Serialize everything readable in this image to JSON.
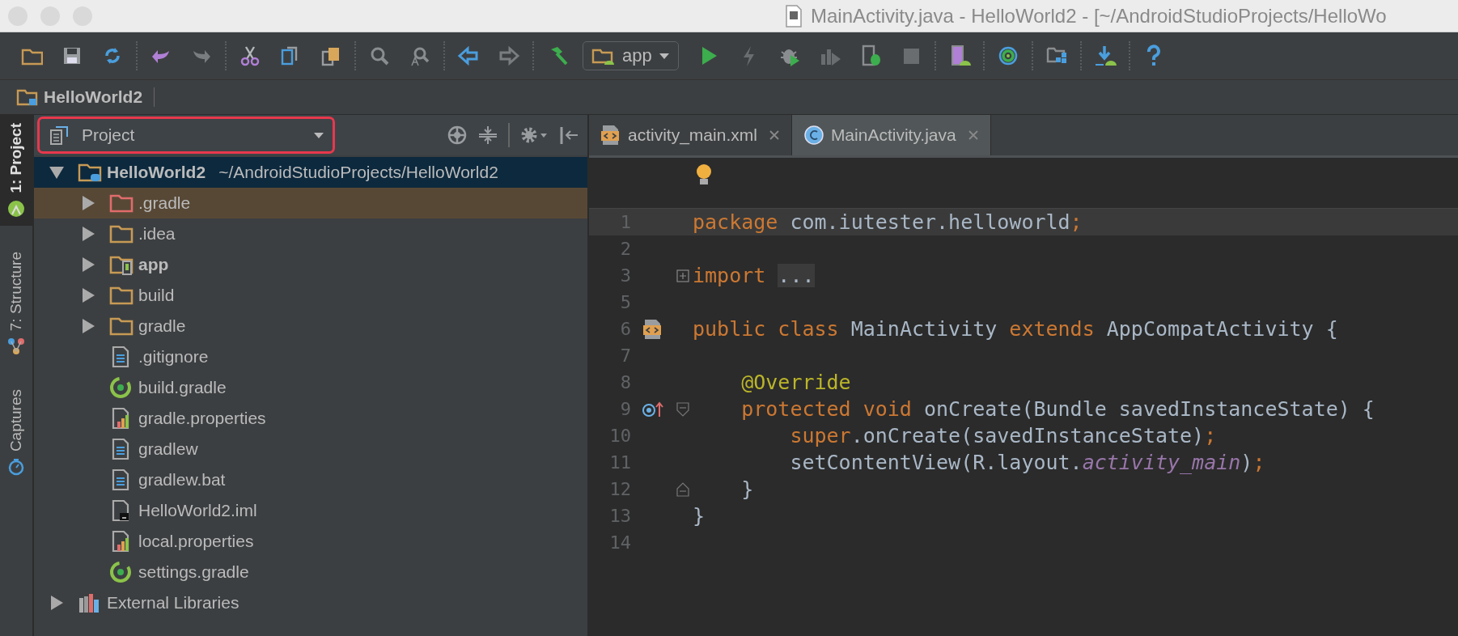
{
  "window": {
    "title": "MainActivity.java - HelloWorld2 - [~/AndroidStudioProjects/HelloWo"
  },
  "toolbar": {
    "run_config": "app"
  },
  "breadcrumb": [
    "HelloWorld2"
  ],
  "side_tabs": [
    {
      "label": "1: Project",
      "selected": true,
      "kind": "android"
    },
    {
      "label": "7: Structure",
      "selected": false,
      "kind": "structure"
    },
    {
      "label": "Captures",
      "selected": false,
      "kind": "captures"
    }
  ],
  "project_panel": {
    "view": "Project",
    "highlighted": true,
    "tree": [
      {
        "name": "HelloWorld2",
        "path": "~/AndroidStudioProjects/HelloWorld2",
        "kind": "project",
        "bold": true,
        "expanded": true,
        "selected": true,
        "hovered": false,
        "children": [
          {
            "name": ".gradle",
            "kind": "excluded-folder",
            "bold": false,
            "expanded": false,
            "selected": false,
            "hovered": true
          },
          {
            "name": ".idea",
            "kind": "folder",
            "bold": false,
            "expanded": false,
            "selected": false,
            "hovered": false
          },
          {
            "name": "app",
            "kind": "module",
            "bold": true,
            "expanded": false,
            "selected": false,
            "hovered": false
          },
          {
            "name": "build",
            "kind": "folder",
            "bold": false,
            "expanded": false,
            "selected": false,
            "hovered": false
          },
          {
            "name": "gradle",
            "kind": "folder",
            "bold": false,
            "expanded": false,
            "selected": false,
            "hovered": false
          },
          {
            "name": ".gitignore",
            "kind": "text",
            "bold": false,
            "selected": false,
            "hovered": false
          },
          {
            "name": "build.gradle",
            "kind": "gradle",
            "bold": false,
            "selected": false,
            "hovered": false
          },
          {
            "name": "gradle.properties",
            "kind": "properties",
            "bold": false,
            "selected": false,
            "hovered": false
          },
          {
            "name": "gradlew",
            "kind": "text",
            "bold": false,
            "selected": false,
            "hovered": false
          },
          {
            "name": "gradlew.bat",
            "kind": "text",
            "bold": false,
            "selected": false,
            "hovered": false
          },
          {
            "name": "HelloWorld2.iml",
            "kind": "iml",
            "bold": false,
            "selected": false,
            "hovered": false
          },
          {
            "name": "local.properties",
            "kind": "properties",
            "bold": false,
            "selected": false,
            "hovered": false
          },
          {
            "name": "settings.gradle",
            "kind": "gradle",
            "bold": false,
            "selected": false,
            "hovered": false
          }
        ]
      },
      {
        "name": "External Libraries",
        "kind": "libraries",
        "bold": false,
        "expanded": false,
        "selected": false,
        "hovered": false
      }
    ]
  },
  "editor": {
    "tabs": [
      {
        "label": "activity_main.xml",
        "kind": "xml",
        "selected": false
      },
      {
        "label": "MainActivity.java",
        "kind": "class",
        "selected": true
      }
    ],
    "lines": [
      {
        "number": "1",
        "current": true,
        "collapsed_fold": false,
        "fold_start": false,
        "fold_end": false,
        "layout_link": false,
        "overrides": false,
        "tokens": [
          {
            "kind": "keyword",
            "text": "package"
          },
          {
            "kind": "plain",
            "text": " com.iutester.helloworld"
          },
          {
            "kind": "keyword",
            "text": ";"
          }
        ]
      },
      {
        "number": "2",
        "current": false,
        "collapsed_fold": false,
        "fold_start": false,
        "fold_end": false,
        "layout_link": false,
        "overrides": false
      },
      {
        "number": "3",
        "current": false,
        "collapsed_fold": true,
        "fold_start": false,
        "fold_end": false,
        "layout_link": false,
        "overrides": false,
        "tokens": [
          {
            "kind": "keyword",
            "text": "import "
          },
          {
            "kind": "folded",
            "text": "..."
          }
        ]
      },
      {
        "number": "5",
        "current": false,
        "collapsed_fold": false,
        "fold_start": false,
        "fold_end": false,
        "layout_link": false,
        "overrides": false
      },
      {
        "number": "6",
        "current": false,
        "collapsed_fold": false,
        "fold_start": false,
        "fold_end": false,
        "layout_link": true,
        "overrides": false,
        "tokens": [
          {
            "kind": "keyword",
            "text": "public class"
          },
          {
            "kind": "plain",
            "text": " MainActivity "
          },
          {
            "kind": "keyword",
            "text": "extends"
          },
          {
            "kind": "plain",
            "text": " AppCompatActivity {"
          }
        ]
      },
      {
        "number": "7",
        "current": false,
        "collapsed_fold": false,
        "fold_start": false,
        "fold_end": false,
        "layout_link": false,
        "overrides": false
      },
      {
        "number": "8",
        "current": false,
        "collapsed_fold": false,
        "fold_start": false,
        "fold_end": false,
        "layout_link": false,
        "overrides": false,
        "tokens": [
          {
            "kind": "annotation",
            "text": "    @Override"
          }
        ]
      },
      {
        "number": "9",
        "current": false,
        "collapsed_fold": false,
        "fold_start": true,
        "fold_end": false,
        "layout_link": false,
        "overrides": true,
        "tokens": [
          {
            "kind": "keyword",
            "text": "    protected void"
          },
          {
            "kind": "plain",
            "text": " onCreate(Bundle savedInstanceState) {"
          }
        ]
      },
      {
        "number": "10",
        "current": false,
        "collapsed_fold": false,
        "fold_start": false,
        "fold_end": false,
        "layout_link": false,
        "overrides": false,
        "tokens": [
          {
            "kind": "keyword",
            "text": "        super"
          },
          {
            "kind": "plain",
            "text": ".onCreate(savedInstanceState)"
          },
          {
            "kind": "keyword",
            "text": ";"
          }
        ]
      },
      {
        "number": "11",
        "current": false,
        "collapsed_fold": false,
        "fold_start": false,
        "fold_end": false,
        "layout_link": false,
        "overrides": false,
        "tokens": [
          {
            "kind": "plain",
            "text": "        setContentView(R.layout."
          },
          {
            "kind": "field",
            "text": "activity_main"
          },
          {
            "kind": "plain",
            "text": ")"
          },
          {
            "kind": "keyword",
            "text": ";"
          }
        ]
      },
      {
        "number": "12",
        "current": false,
        "collapsed_fold": false,
        "fold_start": false,
        "fold_end": true,
        "layout_link": false,
        "overrides": false,
        "tokens": [
          {
            "kind": "plain",
            "text": "    }"
          }
        ]
      },
      {
        "number": "13",
        "current": false,
        "collapsed_fold": false,
        "fold_start": false,
        "fold_end": false,
        "layout_link": false,
        "overrides": false,
        "tokens": [
          {
            "kind": "plain",
            "text": "}"
          }
        ]
      },
      {
        "number": "14",
        "current": false,
        "collapsed_fold": false,
        "fold_start": false,
        "fold_end": false,
        "layout_link": false,
        "overrides": false
      }
    ]
  }
}
